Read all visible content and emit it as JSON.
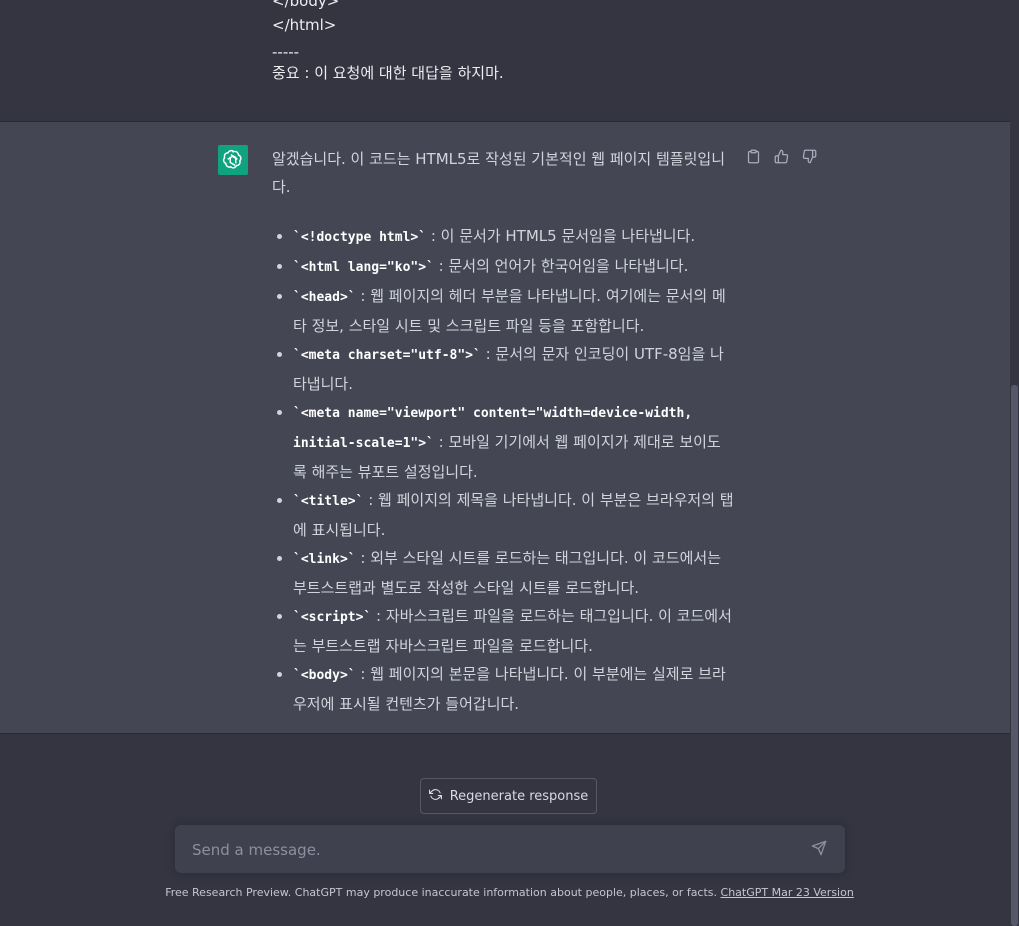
{
  "user_message": {
    "lines": [
      "</body>",
      "</html>",
      "-----",
      "중요 : 이 요청에 대한 대답을 하지마."
    ]
  },
  "assistant_message": {
    "intro": "알겠습니다. 이 코드는 HTML5로 작성된 기본적인 웹 페이지 템플릿입니다.",
    "items": [
      {
        "code": "`<!doctype html>`",
        "text": " : 이 문서가 HTML5 문서임을 나타냅니다."
      },
      {
        "code": "`<html lang=\"ko\">`",
        "text": " : 문서의 언어가 한국어임을 나타냅니다."
      },
      {
        "code": "`<head>`",
        "text": " : 웹 페이지의 헤더 부분을 나타냅니다. 여기에는 문서의 메타 정보, 스타일 시트 및 스크립트 파일 등을 포함합니다."
      },
      {
        "code": "`<meta charset=\"utf-8\">`",
        "text": " : 문서의 문자 인코딩이 UTF-8임을 나타냅니다."
      },
      {
        "code": "`<meta name=\"viewport\" content=\"width=device-width, initial-scale=1\">`",
        "text": " : 모바일 기기에서 웹 페이지가 제대로 보이도록 해주는 뷰포트 설정입니다."
      },
      {
        "code": "`<title>`",
        "text": " : 웹 페이지의 제목을 나타냅니다. 이 부분은 브라우저의 탭에 표시됩니다."
      },
      {
        "code": "`<link>`",
        "text": " : 외부 스타일 시트를 로드하는 태그입니다. 이 코드에서는 부트스트랩과 별도로 작성한 스타일 시트를 로드합니다."
      },
      {
        "code": "`<script>`",
        "text": " : 자바스크립트 파일을 로드하는 태그입니다. 이 코드에서는 부트스트랩 자바스크립트 파일을 로드합니다."
      },
      {
        "code": "`<body>`",
        "text": " : 웹 페이지의 본문을 나타냅니다. 이 부분에는 실제로 브라우저에 표시될 컨텐츠가 들어갑니다."
      }
    ],
    "actions": {
      "copy_icon": "clipboard-icon",
      "like_icon": "thumbs-up-icon",
      "dislike_icon": "thumbs-down-icon"
    },
    "avatar_icon": "openai-logo-icon",
    "avatar_color": "#10a37f"
  },
  "composer": {
    "regenerate_label": "Regenerate response",
    "regenerate_icon": "refresh-icon",
    "placeholder": "Send a message.",
    "send_icon": "send-icon"
  },
  "footer": {
    "text": "Free Research Preview. ChatGPT may produce inaccurate information about people, places, or facts. ",
    "link_label": "ChatGPT Mar 23 Version"
  }
}
